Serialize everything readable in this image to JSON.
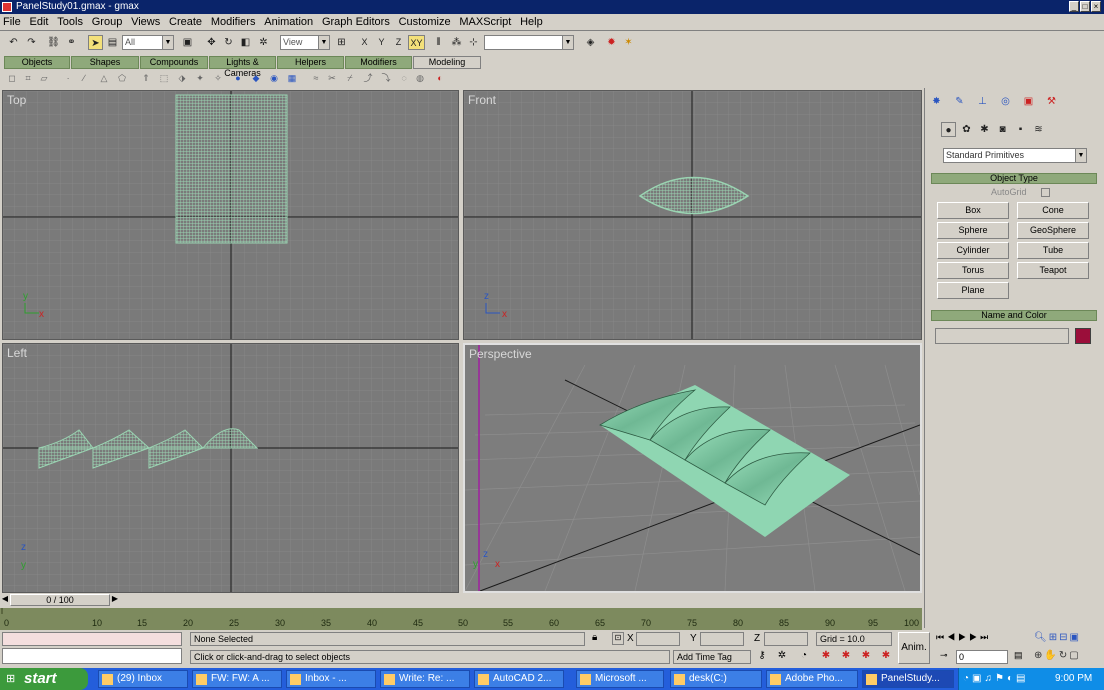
{
  "window": {
    "title": "PanelStudy01.gmax - gmax",
    "controls": [
      "_",
      "□",
      "×"
    ]
  },
  "menu": [
    "File",
    "Edit",
    "Tools",
    "Group",
    "Views",
    "Create",
    "Modifiers",
    "Animation",
    "Graph Editors",
    "Customize",
    "MAXScript",
    "Help"
  ],
  "toolbar": {
    "selection_filter": "All",
    "ref_coord": "View",
    "axis_x": "X",
    "axis_y": "Y",
    "axis_z": "Z",
    "axis_xy": "XY",
    "named_sel": ""
  },
  "tabs": [
    "Objects",
    "Shapes",
    "Compounds",
    "Lights & Cameras",
    "Helpers",
    "Modifiers",
    "Modeling"
  ],
  "viewports": {
    "top": {
      "label": "Top",
      "axis1": "y",
      "axis2": "x"
    },
    "front": {
      "label": "Front",
      "axis1": "z",
      "axis2": "x"
    },
    "left": {
      "label": "Left",
      "axis1": "z",
      "axis2": "y"
    },
    "persp": {
      "label": "Perspective",
      "axis1": "z",
      "axis2": "y",
      "axis3": "x"
    }
  },
  "command_panel": {
    "dropdown": "Standard Primitives",
    "object_type": {
      "header": "Object Type",
      "autogrid": "AutoGrid",
      "buttons": [
        "Box",
        "Cone",
        "Sphere",
        "GeoSphere",
        "Cylinder",
        "Tube",
        "Torus",
        "Teapot",
        "Plane"
      ]
    },
    "name_color": {
      "header": "Name and Color",
      "name_value": "",
      "swatch": "#9b0e3a"
    }
  },
  "time": {
    "slider": "0 / 100",
    "ticks": [
      "0",
      "10",
      "15",
      "20",
      "25",
      "30",
      "35",
      "40",
      "45",
      "50",
      "55",
      "60",
      "65",
      "70",
      "75",
      "80",
      "85",
      "90",
      "95",
      "100"
    ]
  },
  "status": {
    "selection": "None Selected",
    "prompt": "Click or click-and-drag to select objects",
    "x_label": "X",
    "y_label": "Y",
    "z_label": "Z",
    "grid": "Grid = 10.0",
    "add_time_tag": "Add Time Tag",
    "anim": "Anim.",
    "frame": "0"
  },
  "taskbar": {
    "start": "start",
    "tasks": [
      "(29) Inbox",
      "FW: FW: A ...",
      "Inbox - ...",
      "Write: Re: ...",
      "AutoCAD 2...",
      "Microsoft ...",
      "desk(C:)",
      "Adobe Pho...",
      "PanelStudy..."
    ],
    "clock": "9:00 PM"
  },
  "colors": {
    "viewport_bg": "#7a7a7a",
    "grid": "#8c8c8c",
    "mesh": "#9ad4b2",
    "accent_tab": "#8fa97b"
  }
}
